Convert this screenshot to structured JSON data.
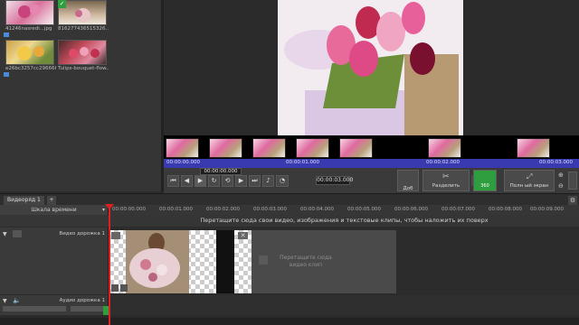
{
  "library": {
    "items": [
      {
        "label": "41246nasredi...jpg",
        "icon": "image-icon"
      },
      {
        "label": "816277436515326...",
        "icon": "image-icon"
      },
      {
        "label": "e26bc3257cc296666...",
        "icon": "image-icon"
      },
      {
        "label": "Tulips-bouquet-flow...",
        "icon": "image-icon"
      }
    ]
  },
  "preview": {
    "ruler": {
      "start": "00:00:00.000",
      "t1": "00:00:01.000",
      "t2": "00:00:02.000",
      "t3": "00:00:03.000"
    },
    "controls": {
      "current_time": "00:00:03.000",
      "small_time": "00:00:00.000",
      "split_label": "Разделить",
      "fullscreen_label": "Полн ый экран",
      "add_label": "Доб",
      "speed_label": "360"
    }
  },
  "timeline": {
    "tab_label": "Видеоряд 1",
    "add_tab": "+",
    "timescale_label": "Шкала времени",
    "ticks": [
      "00:00:00.000",
      "00:00:01.000",
      "00:00:02.000",
      "00:00:03.000",
      "00:00:04.000",
      "00:00:05.000",
      "00:00:06.000",
      "00:00:07.000",
      "00:00:08.000",
      "00:00:09.000"
    ],
    "overlay_hint": "Перетащите сюда свои видео, изображения и текстовые клипы, чтобы наложить их поверх",
    "video_track_label": "Видео дорожка 1",
    "drop_hint": "Перетащите сюда видео клип",
    "audio_track_label": "Аудио дорожка 1"
  },
  "colors": {
    "accent_green": "#2e9e3e",
    "ruler_blue": "#3a3ab0",
    "playhead_red": "#e02020"
  }
}
